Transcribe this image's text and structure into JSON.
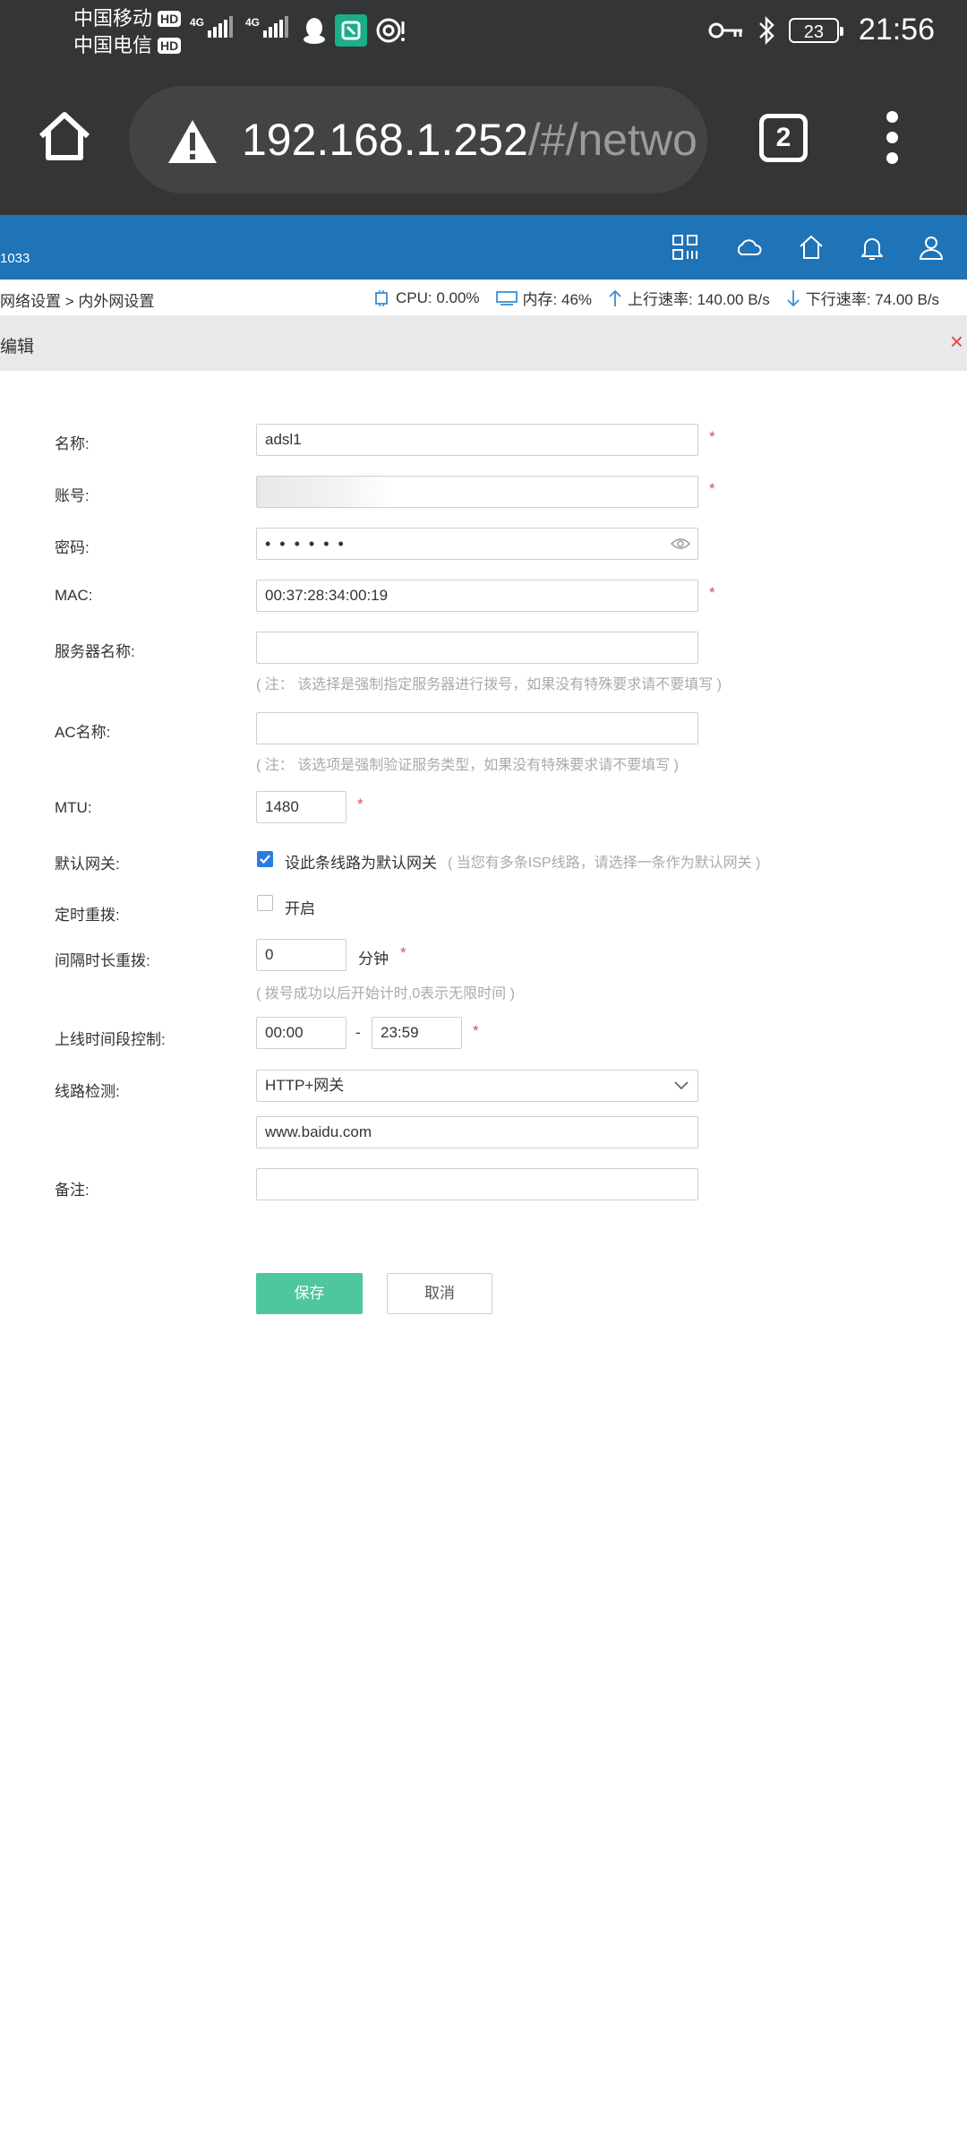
{
  "status_bar": {
    "carrier_1": "中国移动",
    "carrier_2": "中国电信",
    "hd_badge": "HD",
    "network_type": "4G",
    "battery_level": "23",
    "time": "21:56"
  },
  "browser": {
    "url_host": "192.168.1.252",
    "url_path": "/#/netwo",
    "tab_count": "2"
  },
  "app_header": {
    "model": "1033",
    "icons": [
      "grid-icon",
      "cloud-icon",
      "home-icon",
      "bell-icon",
      "user-icon"
    ]
  },
  "info_bar": {
    "breadcrumb": "网络设置 > 内外网设置",
    "cpu": "CPU: 0.00%",
    "memory": "内存: 46%",
    "upload": "上行速率: 140.00 B/s",
    "download": "下行速率: 74.00 B/s"
  },
  "panel": {
    "title": "编辑",
    "close": "×"
  },
  "form": {
    "name": {
      "label": "名称:",
      "value": "adsl1",
      "required": "*"
    },
    "account": {
      "label": "账号:",
      "value": "",
      "required": "*"
    },
    "password": {
      "label": "密码:",
      "value": "••••••"
    },
    "mac": {
      "label": "MAC:",
      "value": "00:37:28:34:00:19",
      "required": "*"
    },
    "server_name": {
      "label": "服务器名称:",
      "value": "",
      "hint": "( 注： 该选择是强制指定服务器进行拨号，如果没有特殊要求请不要填写 )"
    },
    "ac_name": {
      "label": "AC名称:",
      "value": "",
      "hint": "( 注： 该选项是强制验证服务类型，如果没有特殊要求请不要填写 )"
    },
    "mtu": {
      "label": "MTU:",
      "value": "1480",
      "required": "*"
    },
    "default_gateway": {
      "label": "默认网关:",
      "checked": true,
      "checkbox_label": "设此条线路为默认网关",
      "hint": "( 当您有多条ISP线路，请选择一条作为默认网关 )"
    },
    "timed_redial": {
      "label": "定时重拨:",
      "checked": false,
      "checkbox_label": "开启"
    },
    "interval_redial": {
      "label": "间隔时长重拨:",
      "value": "0",
      "unit": "分钟",
      "required": "*",
      "hint": "( 拨号成功以后开始计时,0表示无限时间 )"
    },
    "online_time": {
      "label": "上线时间段控制:",
      "start": "00:00",
      "separator": "-",
      "end": "23:59",
      "required": "*"
    },
    "line_detect": {
      "label": "线路检测:",
      "selected": "HTTP+网关",
      "target": "www.baidu.com"
    },
    "remark": {
      "label": "备注:",
      "value": ""
    }
  },
  "actions": {
    "save": "保存",
    "cancel": "取消"
  },
  "colors": {
    "header_blue": "#1f73b7",
    "save_green": "#4dc79b",
    "required_red": "#e04a4a",
    "checkbox_blue": "#2c7be5",
    "chrome_dark": "#343536"
  }
}
